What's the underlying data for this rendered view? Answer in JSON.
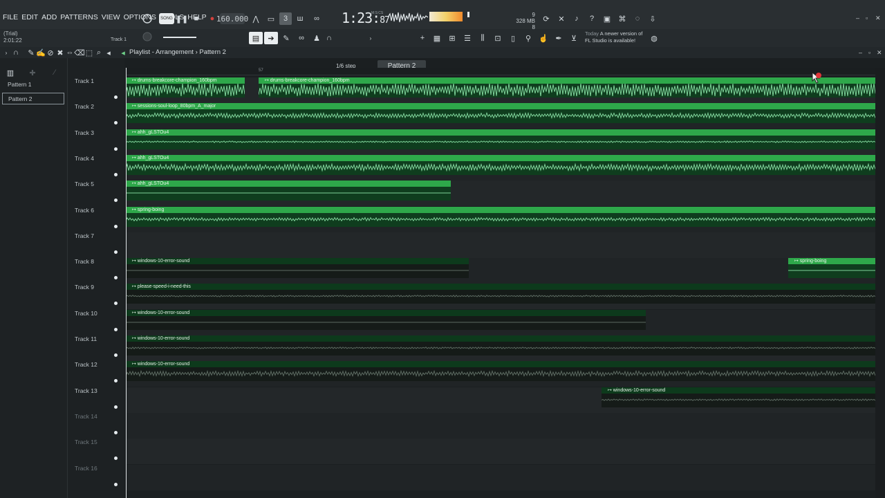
{
  "menu": [
    "FILE",
    "EDIT",
    "ADD",
    "PATTERNS",
    "VIEW",
    "OPTIONS",
    "TOOLS",
    "HELP"
  ],
  "trial": {
    "label": "(Trial)",
    "time": "2:01:22"
  },
  "transport": {
    "song_label": "SONG",
    "bpm": "160.000",
    "time_main": "1:23:",
    "time_frac": "87",
    "time_unit": "M:S:CS"
  },
  "cpu": {
    "line1": "9",
    "line2": "328 MB",
    "line3": "8"
  },
  "toolbar2": {
    "step": "1/6 step",
    "pattern": "Pattern 2",
    "track_hint": "Track 1"
  },
  "news": {
    "when": "Today",
    "line1": "A newer version of",
    "line2": "FL Studio is available!"
  },
  "playlist": {
    "title": "Playlist - Arrangement",
    "sep": "›",
    "pattern": "Pattern 2"
  },
  "patterns": [
    "Pattern 1",
    "Pattern 2"
  ],
  "timeline_marker": "57",
  "tracks": [
    {
      "name": "Track 1",
      "clips": [
        {
          "label": "drums-breakcore-champion_160bpm"
        },
        {
          "label": "drums-breakcore-champion_160bpm"
        }
      ]
    },
    {
      "name": "Track 2",
      "clips": [
        {
          "label": "sessions-soul-loop_80bpm_A_major"
        }
      ]
    },
    {
      "name": "Track 3",
      "clips": [
        {
          "label": "ahh_gLSTOu4"
        }
      ]
    },
    {
      "name": "Track 4",
      "clips": [
        {
          "label": "ahh_gLSTOu4"
        }
      ]
    },
    {
      "name": "Track 5",
      "clips": [
        {
          "label": "ahh_gLSTOu4"
        }
      ]
    },
    {
      "name": "Track 6",
      "clips": [
        {
          "label": "spring-boing"
        }
      ]
    },
    {
      "name": "Track 7",
      "clips": []
    },
    {
      "name": "Track 8",
      "clips": [
        {
          "label": "windows-10-error-sound"
        },
        {
          "label": "spring-boing"
        }
      ]
    },
    {
      "name": "Track 9",
      "clips": [
        {
          "label": "please-speed-i-need-this"
        }
      ]
    },
    {
      "name": "Track 10",
      "clips": [
        {
          "label": "windows-10-error-sound"
        }
      ]
    },
    {
      "name": "Track 11",
      "clips": [
        {
          "label": "windows-10-error-sound"
        }
      ]
    },
    {
      "name": "Track 12",
      "clips": [
        {
          "label": "windows-10-error-sound"
        }
      ]
    },
    {
      "name": "Track 13",
      "clips": [
        {
          "label": "windows-10-error-sound"
        }
      ]
    },
    {
      "name": "Track 14",
      "clips": []
    },
    {
      "name": "Track 15",
      "clips": []
    },
    {
      "name": "Track 16",
      "clips": []
    }
  ],
  "colors": {
    "clip_bright": "#2ea84a",
    "clip_dark": "#0d3a1c",
    "wave": "#7fd39a",
    "accent": "#2fb14f"
  }
}
